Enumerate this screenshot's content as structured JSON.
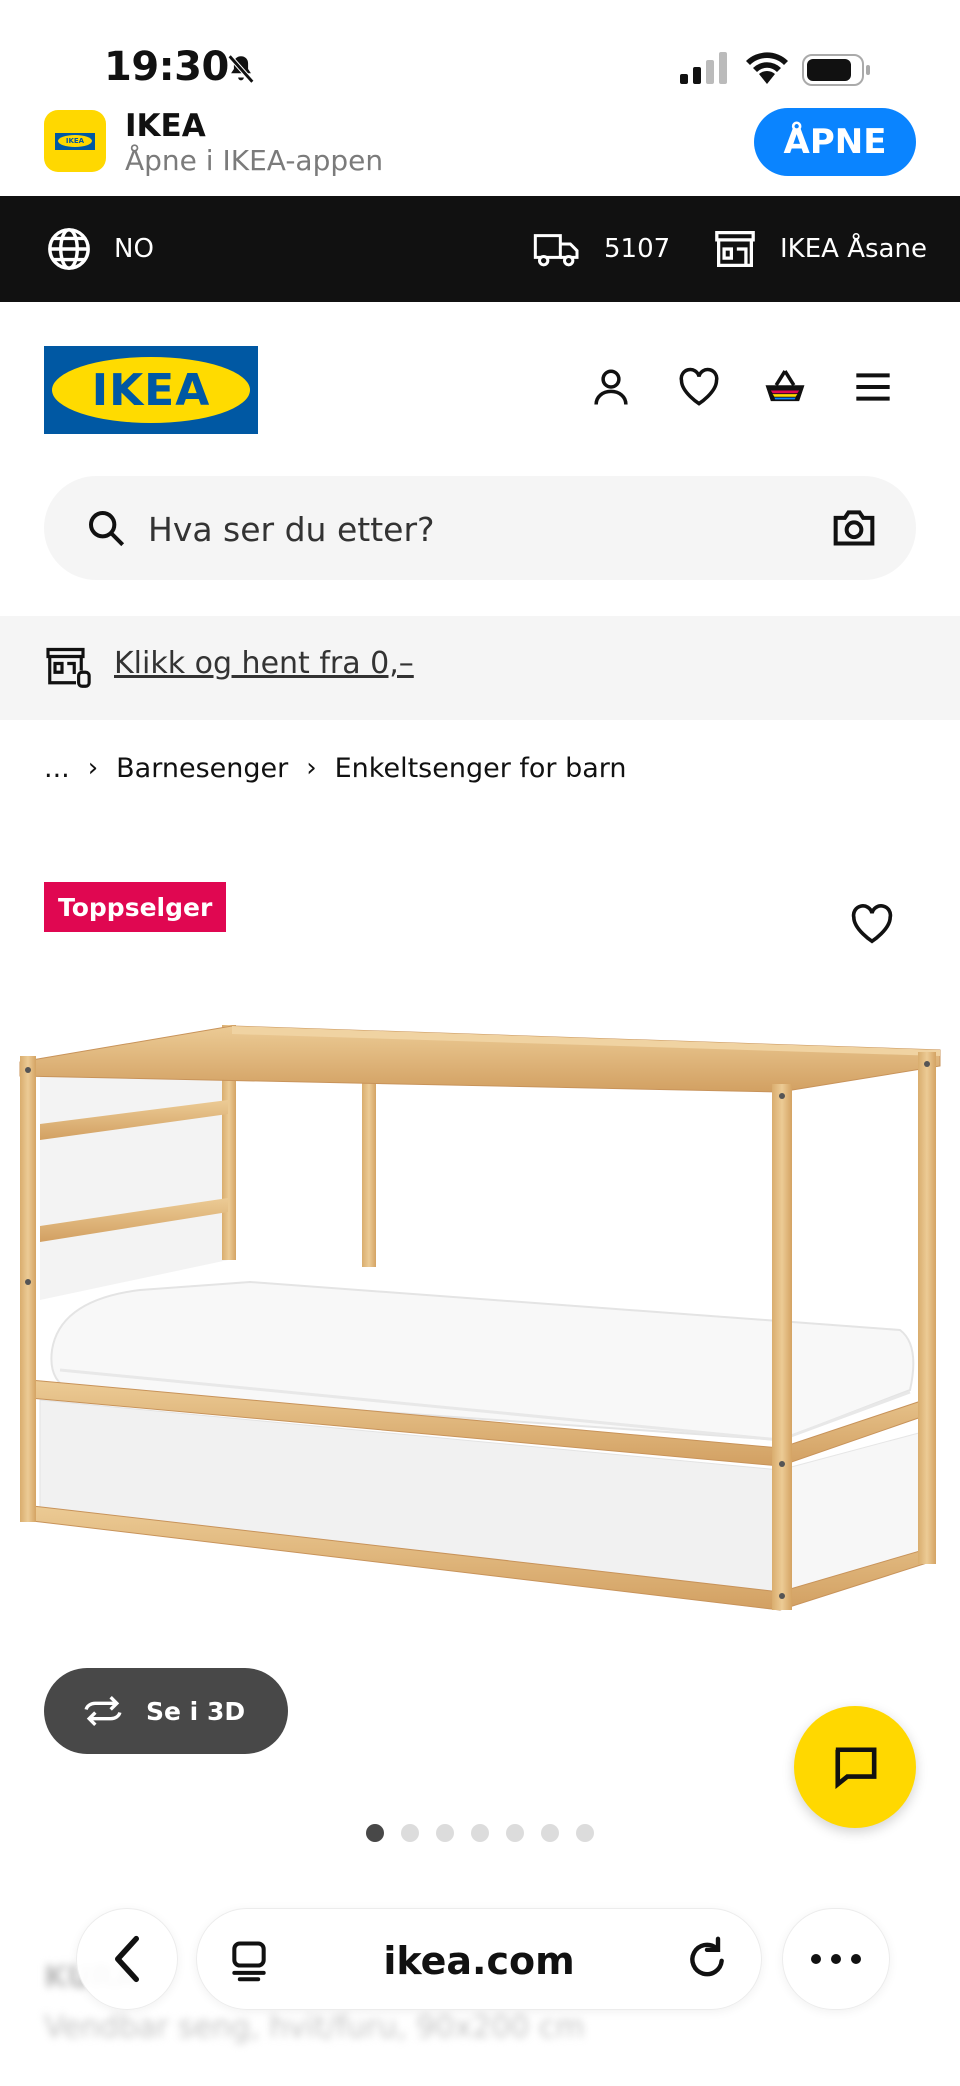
{
  "status_bar": {
    "time": "19:30"
  },
  "app_banner": {
    "app_name": "IKEA",
    "subtitle": "Åpne i IKEA-appen",
    "open_label": "ÅPNE",
    "icon_text": "IKEA"
  },
  "top_bar": {
    "language": "NO",
    "postal_code": "5107",
    "store": "IKEA Åsane"
  },
  "header": {
    "logo_text": "IKEA"
  },
  "search": {
    "placeholder": "Hva ser du etter?"
  },
  "collect_banner": {
    "text": "Klikk og hent fra 0,–"
  },
  "breadcrumb": {
    "items": [
      "...",
      "Barnesenger",
      "Enkeltsenger for barn"
    ],
    "separator": "›"
  },
  "product": {
    "badge": "Toppselger",
    "view_3d_label": "Se i 3D",
    "carousel": {
      "count": 7,
      "active_index": 0
    },
    "title": "KURA",
    "description": "Vendbar seng, hvit/furu, 90x200 cm"
  },
  "browser": {
    "url": "ikea.com"
  },
  "colors": {
    "ikea_blue": "#0058a3",
    "ikea_yellow": "#ffdb00",
    "badge_red": "#e00751",
    "banner_blue": "#0a84ff",
    "top_bar_bg": "#111111"
  },
  "icons": [
    "bell-slash-icon",
    "signal-icon",
    "wifi-icon",
    "battery-icon",
    "globe-icon",
    "truck-icon",
    "store-icon",
    "user-icon",
    "heart-icon",
    "cart-icon",
    "menu-icon",
    "search-icon",
    "camera-icon",
    "collect-store-icon",
    "rotate-3d-icon",
    "chat-icon",
    "back-icon",
    "reader-icon",
    "reload-icon",
    "more-icon"
  ]
}
